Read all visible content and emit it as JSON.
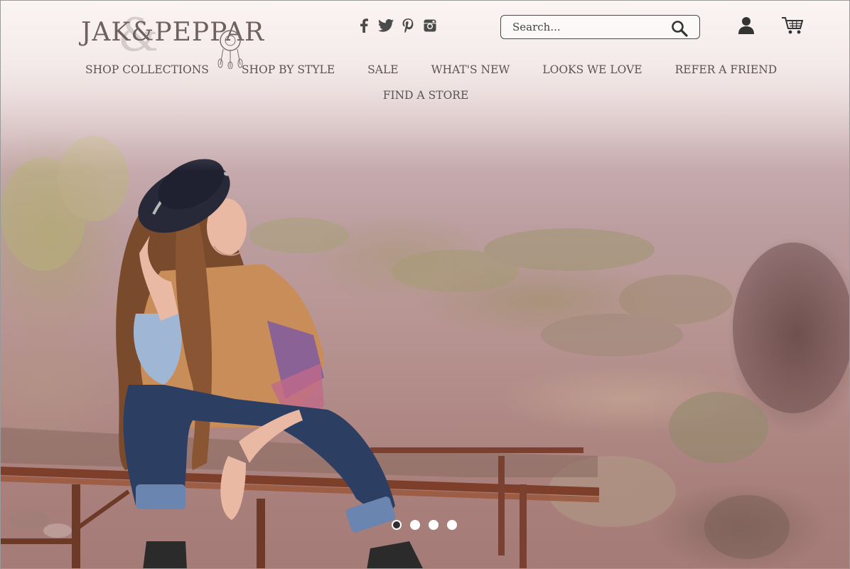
{
  "brand": {
    "logo_text": "JAK&PEPPAR"
  },
  "socials": [
    {
      "icon": "facebook-icon"
    },
    {
      "icon": "twitter-icon"
    },
    {
      "icon": "pinterest-icon"
    },
    {
      "icon": "instagram-icon"
    }
  ],
  "search": {
    "placeholder": "Search..."
  },
  "header_icons": [
    "account-icon",
    "shopping-cart-icon"
  ],
  "nav": {
    "row1": [
      {
        "label": "SHOP COLLECTIONS"
      },
      {
        "label": "SHOP BY STYLE"
      },
      {
        "label": "SALE"
      },
      {
        "label": "WHAT'S NEW"
      },
      {
        "label": "LOOKS WE LOVE"
      },
      {
        "label": "REFER A FRIEND"
      }
    ],
    "row2": [
      {
        "label": "FIND A STORE"
      }
    ]
  },
  "carousel": {
    "slide_count": 4,
    "active_index": 0
  },
  "colors": {
    "text": "#5a5254",
    "icon": "#4b4b4b",
    "hat": "#2a2a3a",
    "jeans": "#2c3f63",
    "hair": "#7a4a2c"
  }
}
